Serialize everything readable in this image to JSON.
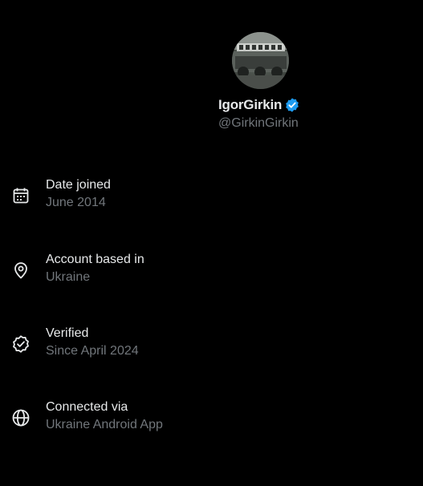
{
  "profile": {
    "display_name": "IgorGirkin",
    "handle": "@GirkinGirkin",
    "verified": true,
    "badge_color": "#1d9bf0"
  },
  "about": {
    "items": [
      {
        "icon": "calendar-icon",
        "label": "Date joined",
        "value": "June 2014"
      },
      {
        "icon": "location-pin-icon",
        "label": "Account based in",
        "value": "Ukraine"
      },
      {
        "icon": "verified-check-icon",
        "label": "Verified",
        "value": "Since April 2024"
      },
      {
        "icon": "globe-icon",
        "label": "Connected via",
        "value": "Ukraine Android App"
      }
    ]
  },
  "colors": {
    "background": "#000000",
    "primary_text": "#e7e9ea",
    "secondary_text": "#71767b",
    "accent": "#1d9bf0"
  }
}
